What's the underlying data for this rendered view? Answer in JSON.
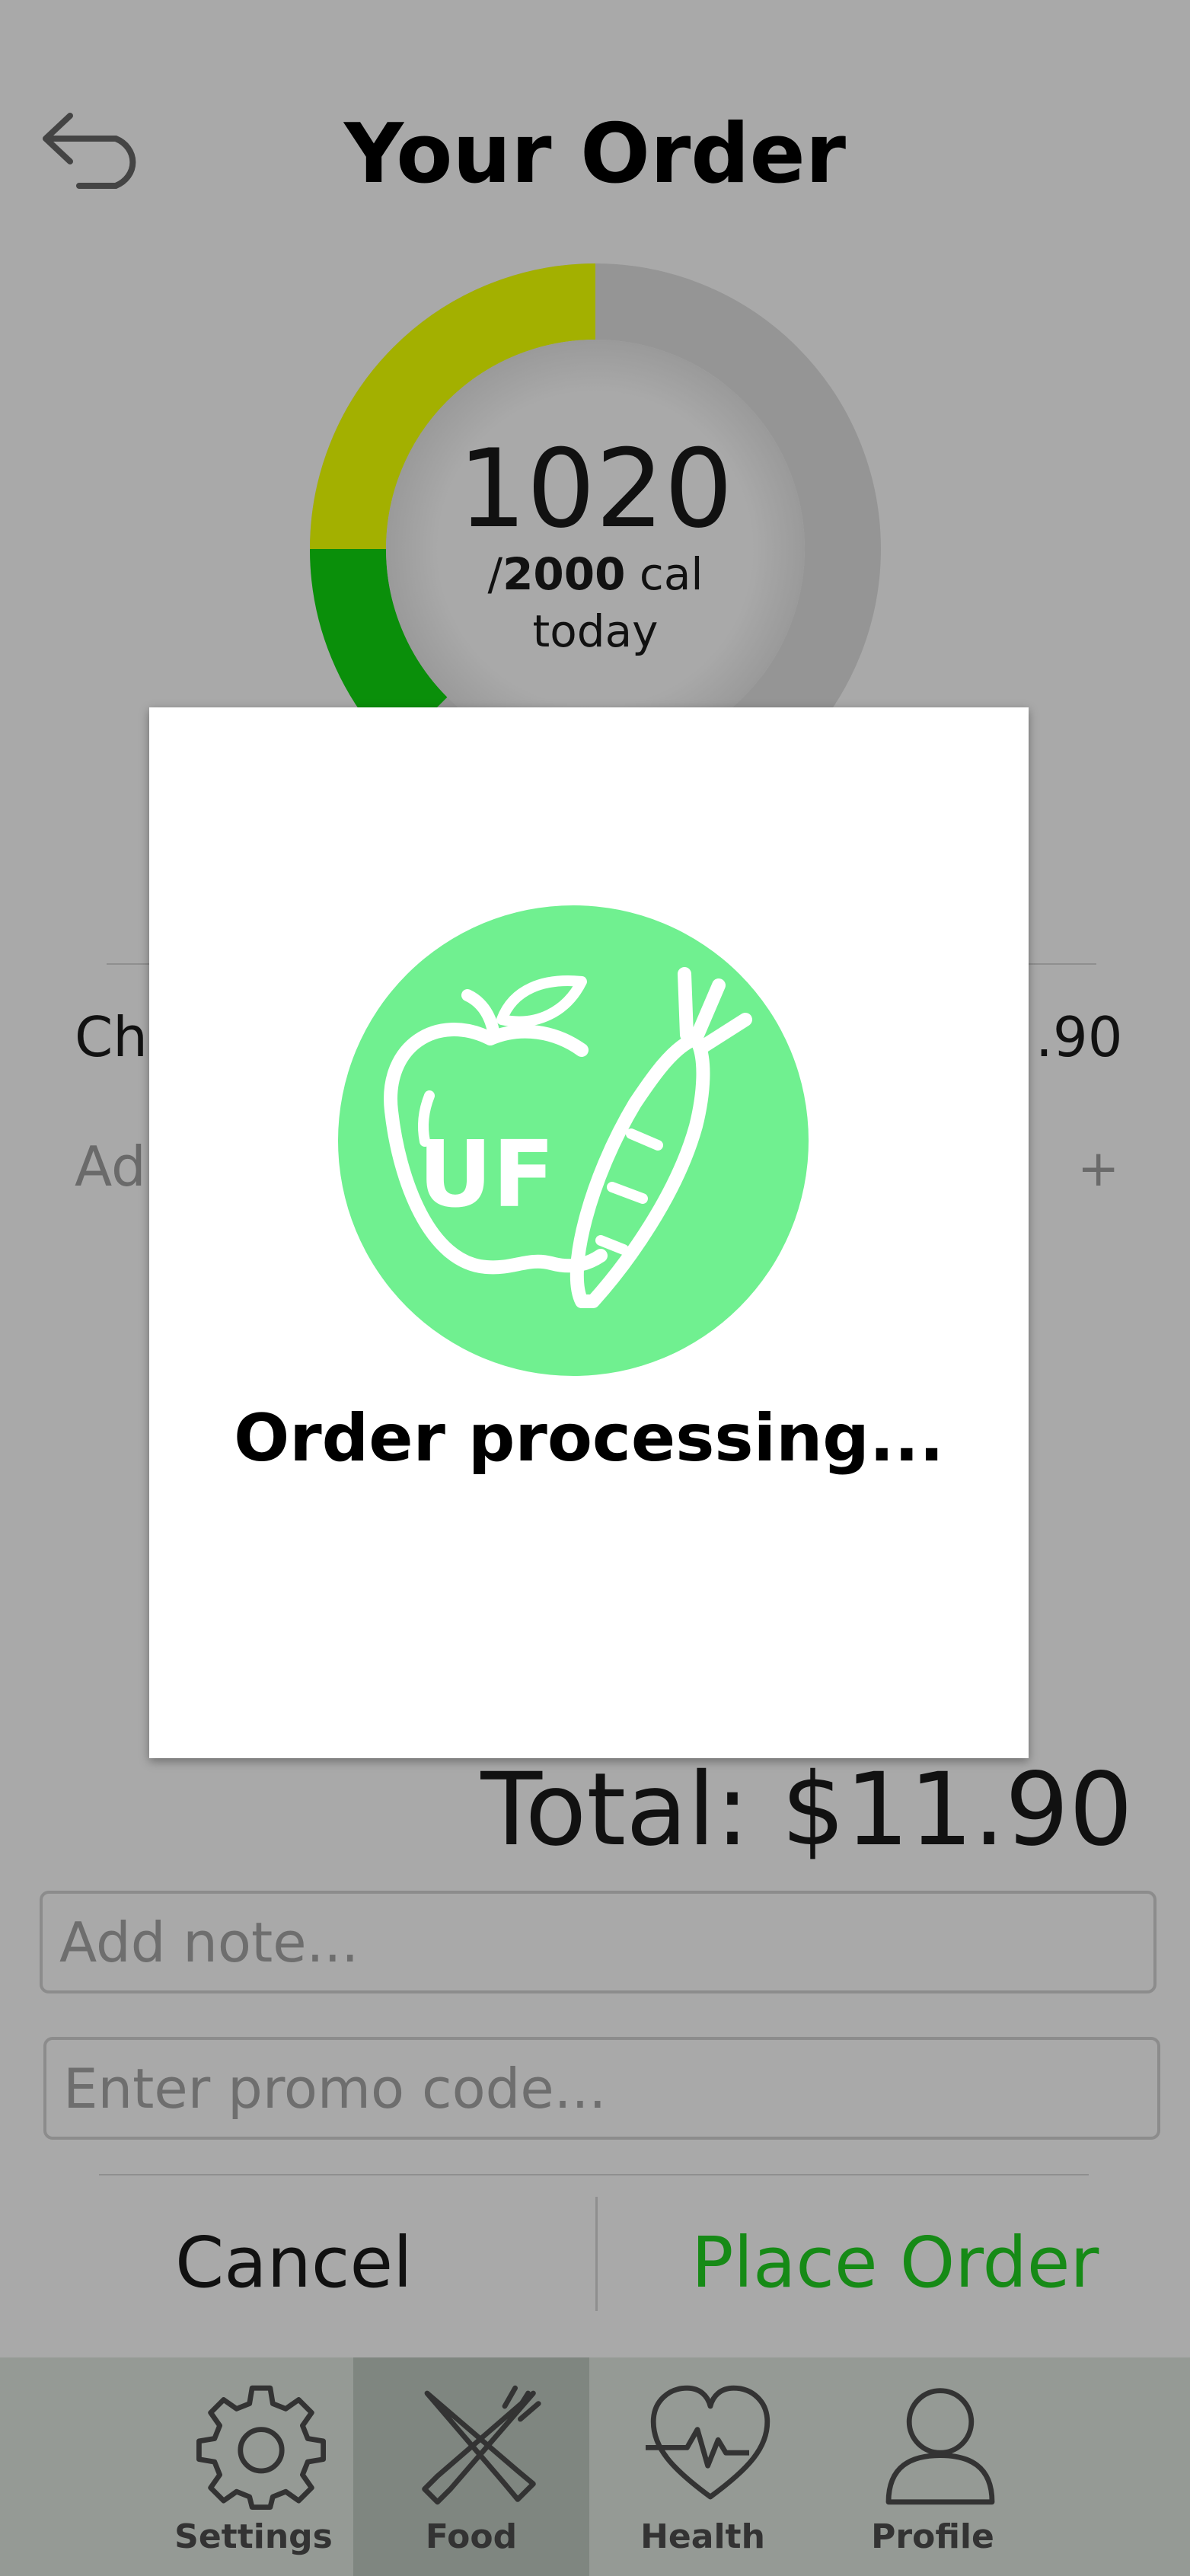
{
  "header": {
    "title": "Your Order",
    "back_icon": "back-arrow-icon"
  },
  "calories": {
    "consumed": "1020",
    "slash": "/",
    "goal": "2000",
    "unit": " cal",
    "period": "today",
    "ring_colors": {
      "green": "#0a8f0a",
      "olive": "#a3b000",
      "track": "#959595"
    }
  },
  "order_item": {
    "name_visible": "Ch",
    "price_visible": ".90"
  },
  "add_item": {
    "label_visible": "Ad",
    "plus": "+"
  },
  "modal": {
    "message": "Order processing...",
    "logo_text": "UF",
    "logo_color": "#70f090"
  },
  "total": {
    "label": "Total: $11.90"
  },
  "inputs": {
    "note_placeholder": "Add note...",
    "promo_placeholder": "Enter promo code..."
  },
  "actions": {
    "cancel": "Cancel",
    "place_order": "Place Order",
    "place_color": "#168a16"
  },
  "nav": [
    {
      "label": "Settings",
      "icon": "gear-icon"
    },
    {
      "label": "Food",
      "icon": "fork-knife-icon",
      "active": true
    },
    {
      "label": "Health",
      "icon": "heart-pulse-icon"
    },
    {
      "label": "Profile",
      "icon": "person-icon"
    }
  ]
}
